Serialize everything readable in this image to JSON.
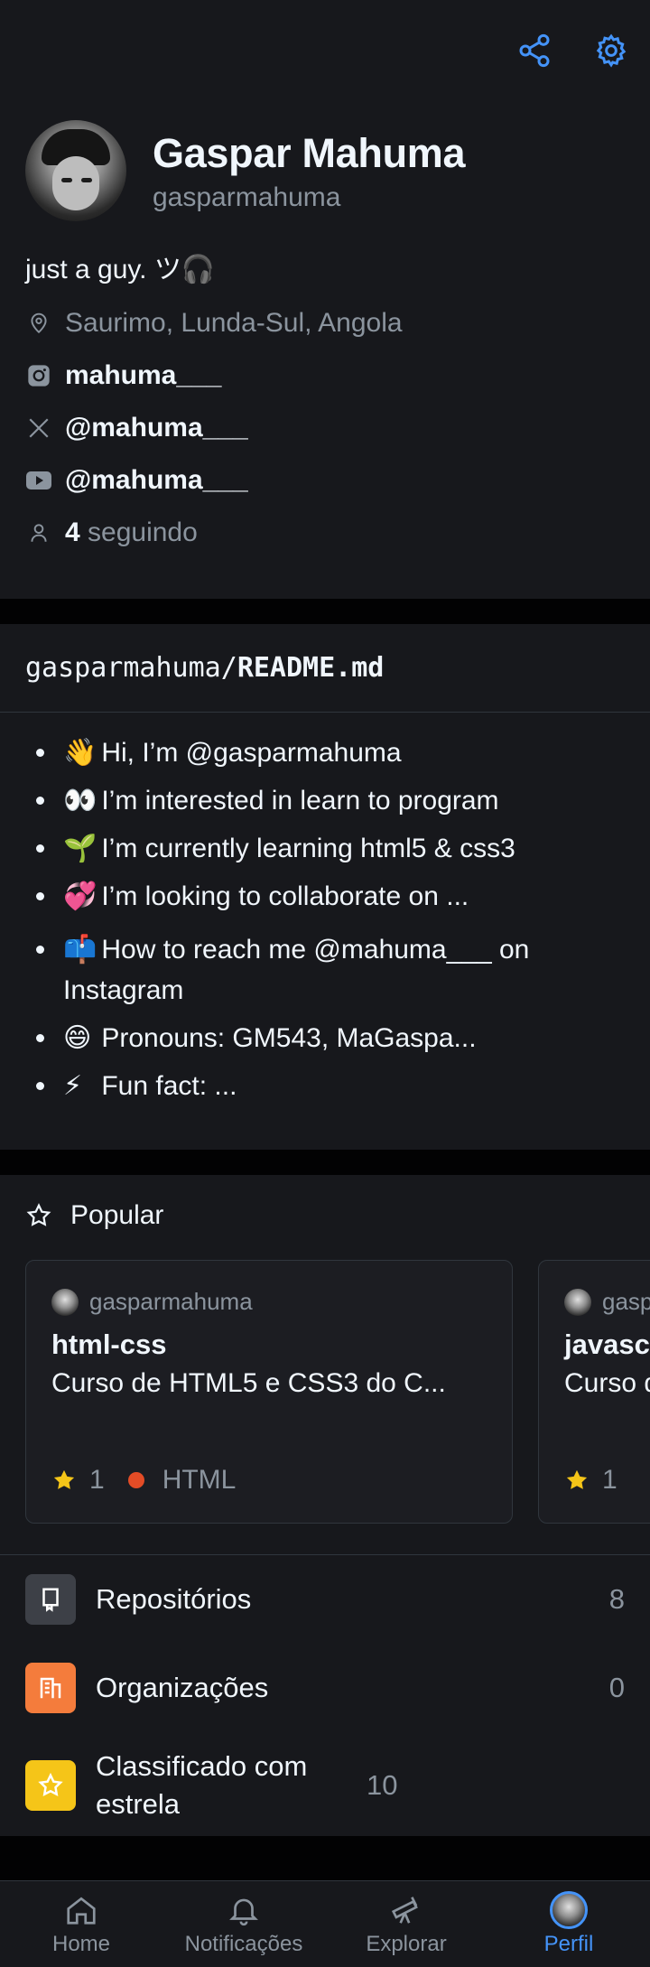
{
  "profile": {
    "name": "Gaspar Mahuma",
    "login": "gasparmahuma",
    "bio": "just a guy. ツ🎧",
    "location": "Saurimo, Lunda-Sul, Angola",
    "instagram": "mahuma___",
    "x_handle": "@mahuma___",
    "youtube": "@mahuma___",
    "following_count": "4",
    "following_label": "seguindo"
  },
  "readme": {
    "owner": "gasparmahuma/",
    "file": "README.md",
    "items": [
      {
        "emoji": "👋",
        "text": "Hi, I’m @gasparmahuma"
      },
      {
        "emoji": "👀",
        "text": "I’m interested in learn to program"
      },
      {
        "emoji": "🌱",
        "text": "I’m currently learning html5 & css3"
      },
      {
        "emoji": "💞️",
        "text": "I’m looking to collaborate on ..."
      },
      {
        "emoji": "📫",
        "text": "How to reach me @mahuma___ on Instagram"
      },
      {
        "emoji": "😄",
        "text": "Pronouns: GM543, MaGaspa..."
      },
      {
        "emoji": "⚡",
        "text": "Fun fact: ..."
      }
    ]
  },
  "popular": {
    "title": "Popular",
    "cards": [
      {
        "owner": "gasparmahuma",
        "repo": "html-css",
        "description": "Curso de HTML5 e CSS3 do C...",
        "stars": "1",
        "language": "HTML",
        "language_color": "#e34c26"
      },
      {
        "owner": "gasparmahuma",
        "repo": "javascript",
        "description": "Curso de JavaScript",
        "stars": "1",
        "language": "",
        "language_color": ""
      }
    ]
  },
  "stats": [
    {
      "label": "Repositórios",
      "count": "8",
      "icon": "repo-icon",
      "color": "#3d4047"
    },
    {
      "label": "Organizações",
      "count": "0",
      "icon": "organization-icon",
      "color": "#f47c3c"
    },
    {
      "label": "Classificado com estrela",
      "count": "10",
      "icon": "star-icon",
      "color": "#f5c518"
    }
  ],
  "nav": {
    "home": "Home",
    "notifications": "Notificações",
    "explore": "Explorar",
    "profile": "Perfil"
  },
  "colors": {
    "accent": "#4493f8",
    "background": "#17181c",
    "muted": "#8b949e"
  }
}
